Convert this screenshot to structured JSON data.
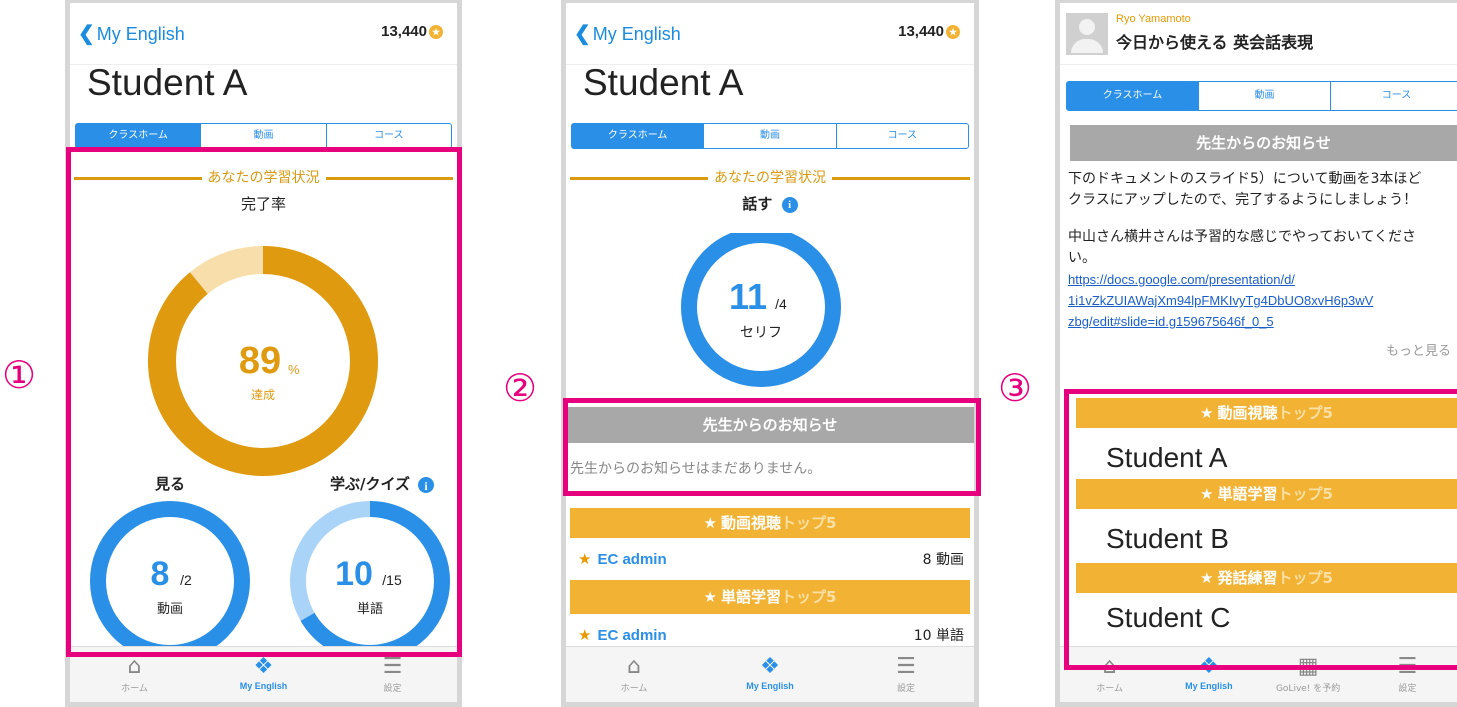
{
  "markers": [
    "①",
    "②",
    "③"
  ],
  "colors": {
    "accent_blue": "#2a8fe6",
    "gold": "#d99a10",
    "highlight_pink": "#e6007e",
    "rank_bar": "#f2b233"
  },
  "screen1": {
    "back_label": "My English",
    "points": "13,440",
    "student": "Student A",
    "tabs": [
      "クラスホーム",
      "動画",
      "コース"
    ],
    "section_title": "あなたの学習状況",
    "completion_title": "完了率",
    "completion_value": "89",
    "completion_unit": "%",
    "completion_caption": "達成",
    "completion_fraction": 0.89,
    "watch_title": "見る",
    "watch_value": "8",
    "watch_total": "/2",
    "watch_unit": "動画",
    "learn_title": "学ぶ/クイズ",
    "learn_value": "10",
    "learn_total": "/15",
    "learn_unit": "単語",
    "learn_fraction": 0.6667
  },
  "screen2": {
    "back_label": "My English",
    "points": "13,440",
    "student": "Student A",
    "tabs": [
      "クラスホーム",
      "動画",
      "コース"
    ],
    "section_title": "あなたの学習状況",
    "speak_title": "話す",
    "speak_value": "11",
    "speak_total": "/4",
    "speak_unit": "セリフ",
    "notice_header": "先生からのお知らせ",
    "notice_empty": "先生からのお知らせはまだありません。",
    "rank1_title_main": "動画視聴",
    "rank1_title_sub": "トップ5",
    "rank1_name": "EC admin",
    "rank1_value": "8 動画",
    "rank2_title_main": "単語学習",
    "rank2_title_sub": "トップ5",
    "rank2_name": "EC admin",
    "rank2_value": "10 単語"
  },
  "screen3": {
    "teacher_name": "Ryo Yamamoto",
    "class_title": "今日から使える 英会話表現",
    "tabs": [
      "クラスホーム",
      "動画",
      "コース"
    ],
    "notice_header": "先生からのお知らせ",
    "notice_line1": "下のドキュメントのスライド5）について動画を3本ほど",
    "notice_line2": "クラスにアップしたので、完了するようにしましょう！",
    "notice_line3": "中山さん横井さんは予習的な感じでやっておいてくださ",
    "notice_line4": "い。",
    "link_line1": "https://docs.google.com/presentation/d/",
    "link_line2": "1i1vZkZUIAWajXm94lpFMKIvyTg4DbUO8xvH6p3wV",
    "link_line3": "zbg/edit#slide=id.g159675646f_0_5",
    "more_label": "もっと見る",
    "rank1_main": "動画視聴",
    "rank1_sub": "トップ5",
    "rank1_student": "Student A",
    "rank2_main": "単語学習",
    "rank2_sub": "トップ5",
    "rank2_student": "Student B",
    "rank3_main": "発話練習",
    "rank3_sub": "トップ5",
    "rank3_student": "Student C"
  },
  "nav": {
    "home": "ホーム",
    "my_english": "My English",
    "settings": "設定",
    "golive": "GoLive! を予約"
  }
}
